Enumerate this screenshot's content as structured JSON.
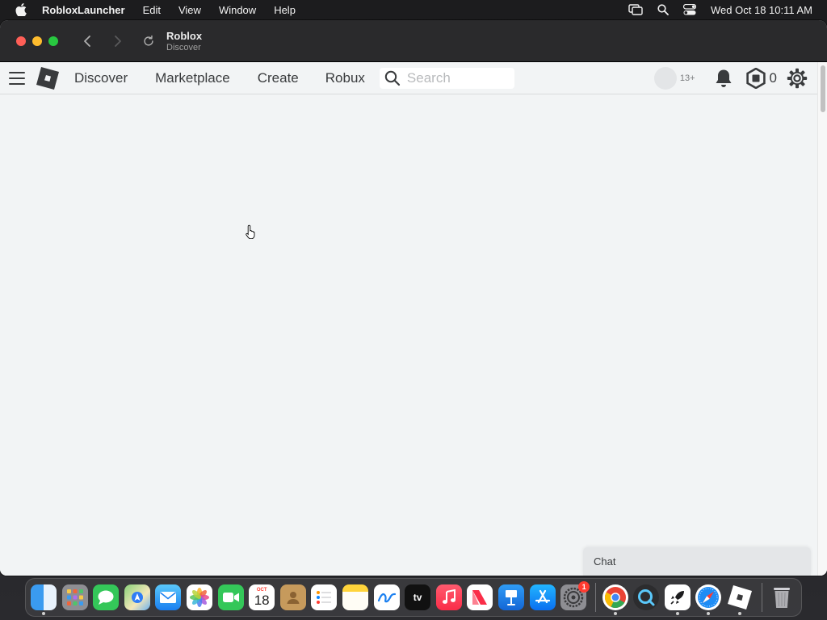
{
  "menubar": {
    "app_name": "RobloxLauncher",
    "menus": [
      "Edit",
      "View",
      "Window",
      "Help"
    ],
    "datetime": "Wed Oct 18  10:11 AM"
  },
  "window": {
    "title": "Roblox",
    "subtitle": "Discover"
  },
  "topnav": {
    "links": [
      "Discover",
      "Marketplace",
      "Create",
      "Robux"
    ],
    "search_placeholder": "Search",
    "age_label": "13+",
    "robux_count": "0"
  },
  "chat": {
    "label": "Chat"
  },
  "dock": {
    "calendar_month": "OCT",
    "calendar_day": "18",
    "settings_badge": "1",
    "appletv_label": "tv",
    "apps": [
      "finder-icon",
      "launchpad-icon",
      "messages-icon",
      "maps-icon",
      "mail-icon",
      "photos-icon",
      "facetime-icon",
      "calendar-icon",
      "contacts-icon",
      "reminders-icon",
      "notes-icon",
      "freeform-icon",
      "appletv-icon",
      "music-icon",
      "news-icon",
      "keynote-icon",
      "appstore-icon",
      "system-settings-icon",
      "chrome-icon",
      "proxyman-icon",
      "rocket-app-icon",
      "safari-icon",
      "roblox-icon",
      "trash-icon"
    ]
  },
  "colors": {
    "page_bg": "#f2f4f5",
    "nav_text": "#393b3d",
    "titlebar": "#2a2a2c"
  }
}
